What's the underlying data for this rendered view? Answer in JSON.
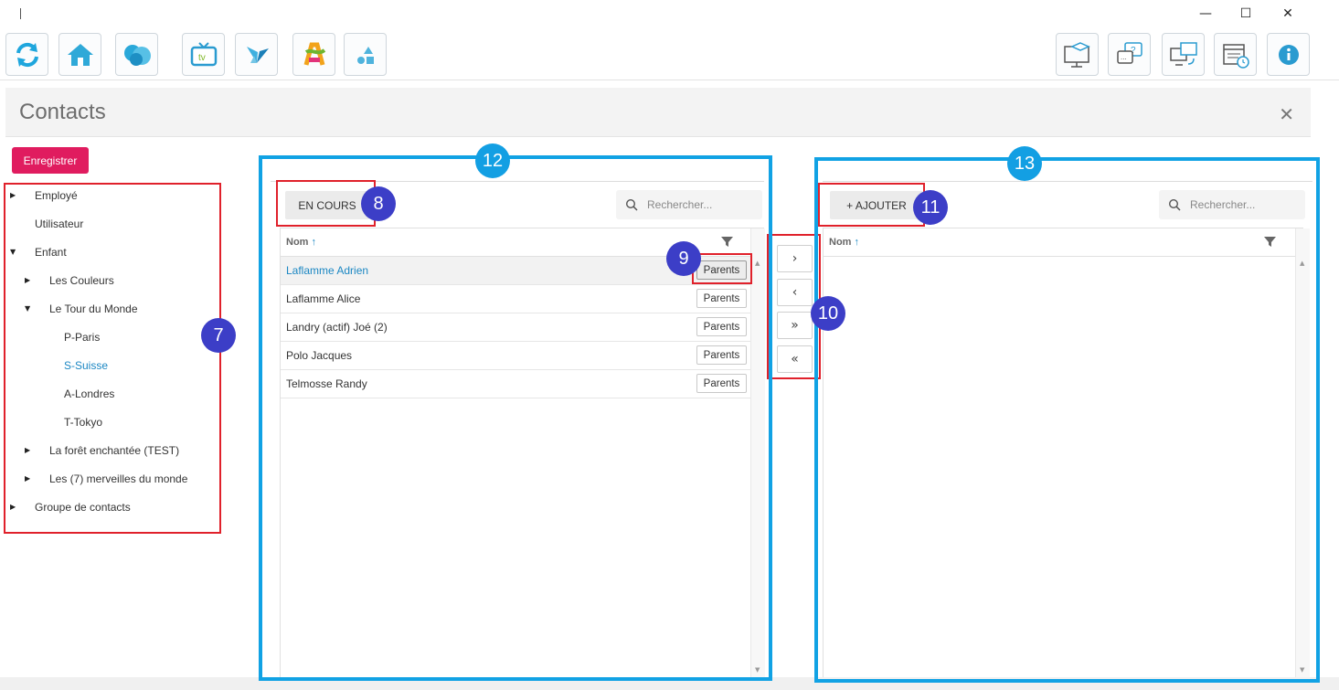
{
  "window": {
    "minimize": "—",
    "maximize": "☐",
    "close": "✕"
  },
  "toolbar": {
    "left_icons": [
      "refresh-icon",
      "home-icon",
      "heart-icon",
      "tv-icon",
      "butterfly-icon",
      "kid-icon",
      "shapes-icon"
    ],
    "right_icons": [
      "computer-graduation-icon",
      "help-chat-icon",
      "computer-sync-icon",
      "calendar-clock-icon",
      "info-icon"
    ],
    "tv_label": "tv"
  },
  "header": {
    "title": "Contacts",
    "close": "✕"
  },
  "save_label": "Enregistrer",
  "tree": {
    "items": [
      {
        "label": "Employé",
        "arrow": "▶"
      },
      {
        "label": "Utilisateur",
        "arrow": ""
      },
      {
        "label": "Enfant",
        "arrow": "▼"
      },
      {
        "label": "Les Couleurs",
        "arrow": "▶"
      },
      {
        "label": "Le Tour du Monde",
        "arrow": "▼"
      },
      {
        "label": "P-Paris",
        "arrow": ""
      },
      {
        "label": "S-Suisse",
        "arrow": "",
        "selected": true
      },
      {
        "label": "A-Londres",
        "arrow": ""
      },
      {
        "label": "T-Tokyo",
        "arrow": ""
      },
      {
        "label": "La forêt enchantée (TEST)",
        "arrow": "▶"
      },
      {
        "label": "Les (7) merveilles du monde",
        "arrow": "▶"
      },
      {
        "label": "Groupe de contacts",
        "arrow": "▶"
      }
    ]
  },
  "left_panel": {
    "status_button": "EN COURS",
    "search_placeholder": "Rechercher...",
    "column_name": "Nom",
    "sort_arrow": "↑",
    "rows": [
      {
        "name": "Laflamme Adrien",
        "action": "Parents",
        "selected": true
      },
      {
        "name": "Laflamme Alice",
        "action": "Parents"
      },
      {
        "name": "Landry (actif) Joé (2)",
        "action": "Parents"
      },
      {
        "name": "Polo Jacques",
        "action": "Parents"
      },
      {
        "name": "Telmosse Randy",
        "action": "Parents"
      }
    ]
  },
  "transfer": {
    "move_right": "›",
    "move_left": "‹",
    "move_all_right": "»",
    "move_all_left": "«"
  },
  "right_panel": {
    "add_button": "+ AJOUTER",
    "search_placeholder": "Rechercher...",
    "column_name": "Nom",
    "sort_arrow": "↑"
  },
  "annotations": {
    "b7": "7",
    "b8": "8",
    "b9": "9",
    "b10": "10",
    "b11": "11",
    "b12": "12",
    "b13": "13"
  },
  "colors": {
    "accent_blue": "#1b87c3",
    "save_pink": "#e01c5f",
    "annotation_red": "#e0212b",
    "annotation_blue": "#11a2e4",
    "badge_indigo": "#3c3ec7"
  }
}
